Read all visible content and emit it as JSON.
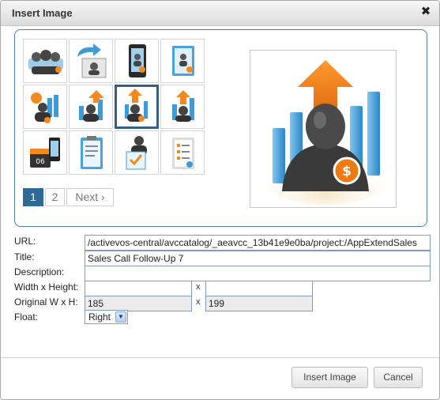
{
  "dialog": {
    "title": "Insert Image"
  },
  "thumbnails": [
    {
      "icon": "people-group-icon",
      "selected": false
    },
    {
      "icon": "share-group-icon",
      "selected": false
    },
    {
      "icon": "mobile-contact-icon",
      "selected": false
    },
    {
      "icon": "address-book-icon",
      "selected": false
    },
    {
      "icon": "support-chart-icon",
      "selected": false
    },
    {
      "icon": "sales-growth-icon",
      "selected": false
    },
    {
      "icon": "sales-call-followup-icon",
      "selected": true
    },
    {
      "icon": "sales-target-icon",
      "selected": false
    },
    {
      "icon": "calendar-phone-icon",
      "selected": false
    },
    {
      "icon": "clipboard-checklist-icon",
      "selected": false
    },
    {
      "icon": "person-checklist-icon",
      "selected": false
    },
    {
      "icon": "task-list-icon",
      "selected": false
    }
  ],
  "pager": {
    "page1": "1",
    "page2": "2",
    "next": "Next ›"
  },
  "form": {
    "url_label": "URL:",
    "url_value": "/activevos-central/avccatalog/_aeavcc_13b41e9e0ba/project:/AppExtendSales",
    "title_label": "Title:",
    "title_value": "Sales Call Follow-Up 7",
    "description_label": "Description:",
    "description_value": "",
    "wh_label": "Width x Height:",
    "width_value": "",
    "height_value": "",
    "x_sep": "x",
    "orig_label": "Original W x H:",
    "orig_width": "185",
    "orig_height": "199",
    "float_label": "Float:",
    "float_value": "Right"
  },
  "buttons": {
    "insert": "Insert Image",
    "cancel": "Cancel"
  },
  "colors": {
    "accent": "#2f6a97",
    "orange": "#f28a1f",
    "blue": "#3d9bd6"
  }
}
